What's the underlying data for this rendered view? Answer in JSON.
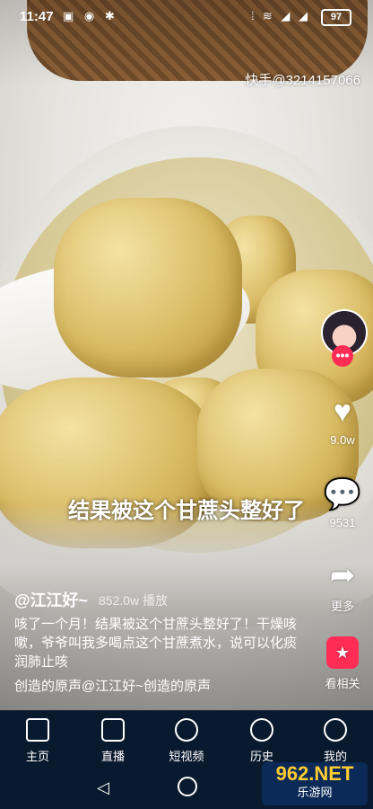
{
  "status_bar": {
    "time": "11:47",
    "battery": "97"
  },
  "watermark": "快手@3214157066",
  "subtitle": "结果被这个甘蔗头整好了",
  "actions": {
    "likes": "9.0w",
    "comments": "9531",
    "share_label": "更多",
    "related_label": "看相关"
  },
  "post": {
    "author": "@江江好~",
    "plays": "852.0w 播放",
    "description": "咳了一个月！结果被这个甘蔗头整好了！干燥咳嗽，爷爷叫我多喝点这个甘蔗煮水，说可以化痰润肺止咳",
    "music": "创造的原声@江江好~创造的原声"
  },
  "tabs": [
    {
      "label": "主页"
    },
    {
      "label": "直播"
    },
    {
      "label": "短视频"
    },
    {
      "label": "历史"
    },
    {
      "label": "我的"
    }
  ],
  "logo": {
    "big": "962.NET",
    "small": "乐游网"
  }
}
